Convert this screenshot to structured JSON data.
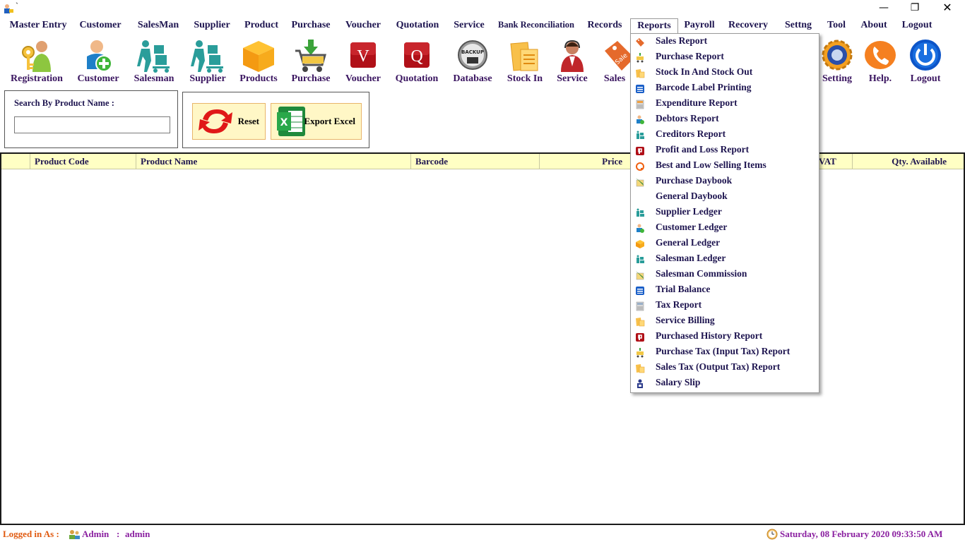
{
  "window": {
    "title": "`",
    "min": "—",
    "max": "❐",
    "close": "✕"
  },
  "menu": [
    "Master Entry",
    "Customer",
    "SalesMan",
    "Supplier",
    "Product",
    "Purchase",
    "Voucher",
    "Quotation",
    "Service",
    "Bank Reconciliation",
    "Records",
    "Reports",
    "Payroll",
    "Recovery",
    "Settng",
    "Tool",
    "About",
    "Logout"
  ],
  "toolbar": {
    "registration": "Registration",
    "customer": "Customer",
    "salesman": "Salesman",
    "supplier": "Supplier",
    "products": "Products",
    "purchase": "Purchase",
    "voucher": "Voucher",
    "quotation": "Quotation",
    "database": "Database",
    "stock_in": "Stock In",
    "service": "Service",
    "sales": "Sales",
    "setting": "Setting",
    "help": "Help.",
    "logout": "Logout",
    "voucher_glyph": "V",
    "quotation_glyph": "Q",
    "backup_text": "BACKUP",
    "sale_tag": "Sale"
  },
  "search": {
    "label": "Search By Product Name :",
    "value": ""
  },
  "buttons": {
    "reset": "Reset",
    "export": "Export Excel",
    "excel_glyph": "X"
  },
  "grid": {
    "columns": [
      "Product Code",
      "Product Name",
      "Barcode",
      "Price",
      "VAT",
      "Qty. Available"
    ]
  },
  "reports_menu": [
    {
      "label": "Sales Report",
      "icon": "sales-tag-icon"
    },
    {
      "label": "Purchase Report",
      "icon": "cart-icon"
    },
    {
      "label": "Stock In And Stock Out",
      "icon": "folder-icon"
    },
    {
      "label": "Barcode Label Printing",
      "icon": "list-icon"
    },
    {
      "label": "Expenditure Report",
      "icon": "calculator-icon"
    },
    {
      "label": "Debtors Report",
      "icon": "customer-icon"
    },
    {
      "label": "Creditors Report",
      "icon": "supplier-icon"
    },
    {
      "label": "Profit and Loss Report",
      "icon": "p-icon"
    },
    {
      "label": "Best and Low Selling Items",
      "icon": "quotation-icon"
    },
    {
      "label": "Purchase Daybook",
      "icon": "pen-icon"
    },
    {
      "label": "General Daybook",
      "icon": ""
    },
    {
      "label": "Supplier Ledger",
      "icon": "supplier-icon"
    },
    {
      "label": "Customer Ledger",
      "icon": "customer-icon"
    },
    {
      "label": "General Ledger",
      "icon": "box-icon"
    },
    {
      "label": "Salesman Ledger",
      "icon": "supplier-icon"
    },
    {
      "label": "Salesman Commission",
      "icon": "pen-icon"
    },
    {
      "label": "Trial Balance",
      "icon": "list-icon"
    },
    {
      "label": "Tax Report",
      "icon": "calculator-icon"
    },
    {
      "label": "Service Billing",
      "icon": "folder-icon"
    },
    {
      "label": "Purchased History Report",
      "icon": "p-icon"
    },
    {
      "label": "Purchase Tax (Input Tax) Report",
      "icon": "cart-icon"
    },
    {
      "label": "Sales Tax (Output Tax) Report",
      "icon": "folder-icon"
    },
    {
      "label": "Salary Slip",
      "icon": "salary-icon"
    }
  ],
  "status": {
    "logged_in_label": "Logged in As :",
    "user": "Admin",
    "separator": ":",
    "role": "admin",
    "datetime": "Saturday, 08 February 2020 09:33:50 AM"
  },
  "colors": {
    "menu_text": "#1e1550",
    "grid_header_bg": "#ffffc4",
    "button_bg": "#fff7c6",
    "status_orange": "#e05a10",
    "status_purple": "#8a1fa0"
  }
}
